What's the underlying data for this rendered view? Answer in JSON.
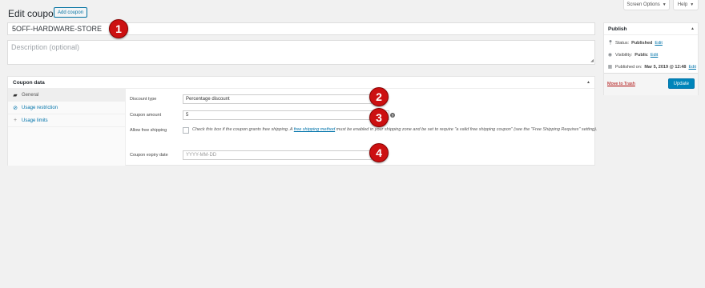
{
  "header": {
    "screen_options": "Screen Options",
    "help": "Help",
    "title": "Edit coupon",
    "add_coupon": "Add coupon"
  },
  "coupon": {
    "code": "5OFF-HARDWARE-STORE",
    "description_placeholder": "Description (optional)"
  },
  "markers": [
    "1",
    "2",
    "3",
    "4"
  ],
  "coupon_data": {
    "heading": "Coupon data",
    "tabs": [
      {
        "label": "General",
        "icon": "ticket-icon",
        "active": true
      },
      {
        "label": "Usage restriction",
        "icon": "restriction-icon",
        "active": false
      },
      {
        "label": "Usage limits",
        "icon": "plus-icon",
        "active": false
      }
    ],
    "fields": {
      "discount_type_label": "Discount type",
      "discount_type_value": "Percentage discount",
      "coupon_amount_label": "Coupon amount",
      "coupon_amount_value": "5",
      "free_shipping_label": "Allow free shipping",
      "free_shipping_text_1": "Check this box if the coupon grants free shipping. A ",
      "free_shipping_link": "free shipping method",
      "free_shipping_text_2": " must be enabled in your shipping zone and be set to require \"a valid free shipping coupon\" (see the \"Free Shipping Requires\" setting).",
      "expiry_label": "Coupon expiry date",
      "expiry_placeholder": "YYYY-MM-DD"
    }
  },
  "publish": {
    "heading": "Publish",
    "status_label": "Status:",
    "status_value": "Published",
    "visibility_label": "Visibility:",
    "visibility_value": "Public",
    "published_label": "Published on:",
    "published_value": "Mar 5, 2019 @ 12:48",
    "edit": "Edit",
    "trash": "Move to Trash",
    "update": "Update"
  },
  "colors": {
    "accent": "#0073aa",
    "update_button": "#0085ba",
    "marker": "#cc1011",
    "trash": "#aa0000"
  }
}
